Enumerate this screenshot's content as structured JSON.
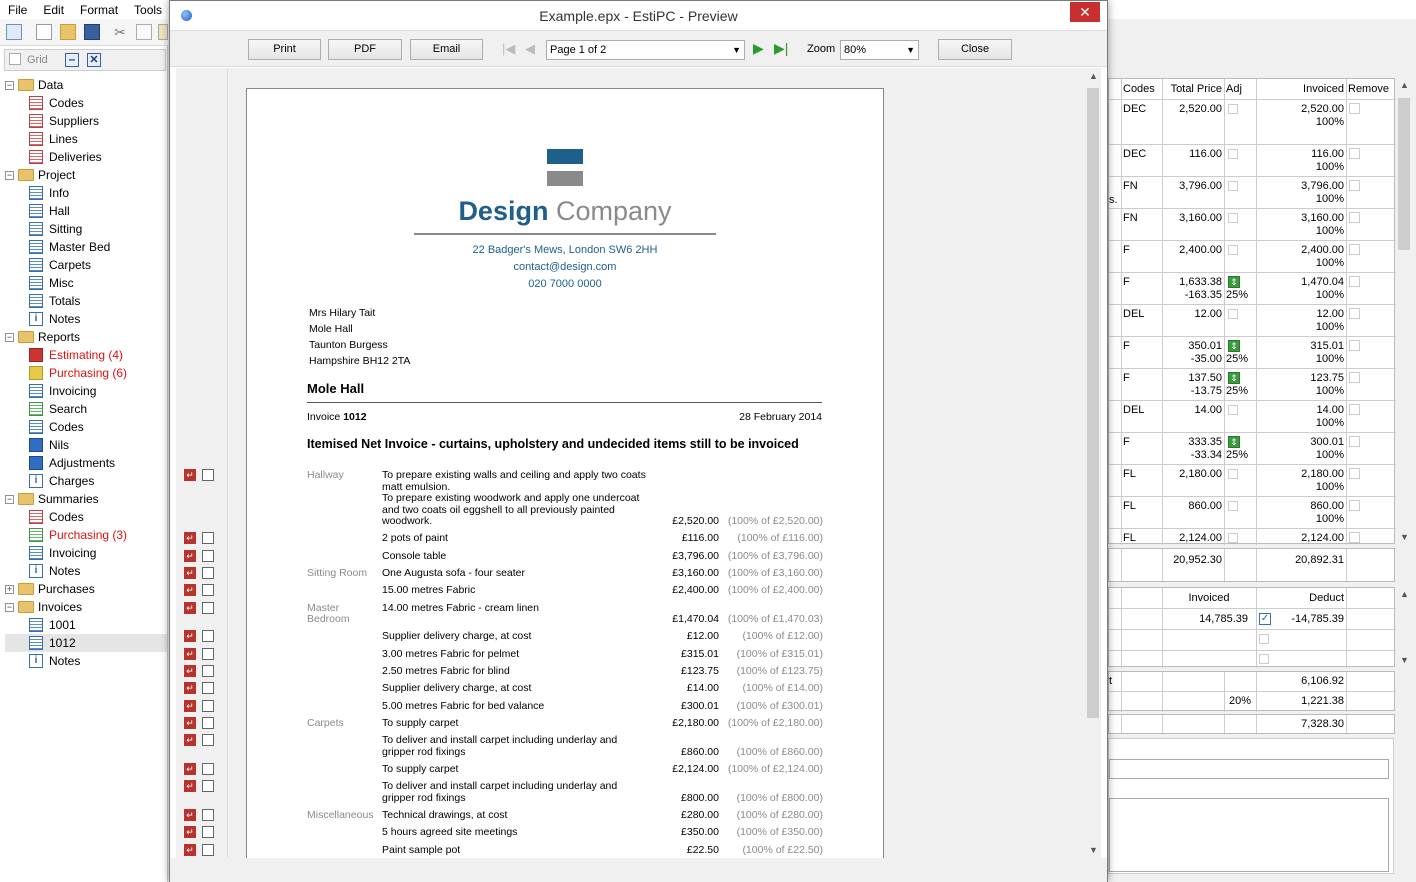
{
  "menu": [
    "File",
    "Edit",
    "Format",
    "Tools"
  ],
  "gridbar": {
    "label": "Grid"
  },
  "tree": [
    {
      "label": "Data",
      "lvl": 0,
      "exp": "−",
      "ico": "fold"
    },
    {
      "label": "Codes",
      "lvl": 1,
      "ico": "red"
    },
    {
      "label": "Suppliers",
      "lvl": 1,
      "ico": "red"
    },
    {
      "label": "Lines",
      "lvl": 1,
      "ico": "red"
    },
    {
      "label": "Deliveries",
      "lvl": 1,
      "ico": "red"
    },
    {
      "label": "Project",
      "lvl": 0,
      "exp": "−",
      "ico": "fold"
    },
    {
      "label": "Info",
      "lvl": 1,
      "ico": "blue"
    },
    {
      "label": "Hall",
      "lvl": 1,
      "ico": "blue"
    },
    {
      "label": "Sitting",
      "lvl": 1,
      "ico": "blue"
    },
    {
      "label": "Master Bed",
      "lvl": 1,
      "ico": "blue"
    },
    {
      "label": "Carpets",
      "lvl": 1,
      "ico": "blue"
    },
    {
      "label": "Misc",
      "lvl": 1,
      "ico": "blue"
    },
    {
      "label": "Totals",
      "lvl": 1,
      "ico": "blue"
    },
    {
      "label": "Notes",
      "lvl": 1,
      "ico": "info"
    },
    {
      "label": "Reports",
      "lvl": 0,
      "exp": "−",
      "ico": "fold"
    },
    {
      "label": "Estimating (4)",
      "lvl": 1,
      "ico": "rb",
      "red": true
    },
    {
      "label": "Purchasing (6)",
      "lvl": 1,
      "ico": "yb",
      "red": true
    },
    {
      "label": "Invoicing",
      "lvl": 1,
      "ico": "blue"
    },
    {
      "label": "Search",
      "lvl": 1,
      "ico": "grn"
    },
    {
      "label": "Codes",
      "lvl": 1,
      "ico": "blue"
    },
    {
      "label": "Nils",
      "lvl": 1,
      "ico": "bb"
    },
    {
      "label": "Adjustments",
      "lvl": 1,
      "ico": "bb"
    },
    {
      "label": "Charges",
      "lvl": 1,
      "ico": "info"
    },
    {
      "label": "Summaries",
      "lvl": 0,
      "exp": "−",
      "ico": "fold"
    },
    {
      "label": "Codes",
      "lvl": 1,
      "ico": "red"
    },
    {
      "label": "Purchasing (3)",
      "lvl": 1,
      "ico": "grn",
      "red": true
    },
    {
      "label": "Invoicing",
      "lvl": 1,
      "ico": "blue"
    },
    {
      "label": "Notes",
      "lvl": 1,
      "ico": "info"
    },
    {
      "label": "Purchases",
      "lvl": 0,
      "exp": "+",
      "ico": "fold"
    },
    {
      "label": "Invoices",
      "lvl": 0,
      "exp": "−",
      "ico": "fold"
    },
    {
      "label": "1001",
      "lvl": 1,
      "ico": "blue"
    },
    {
      "label": "1012",
      "lvl": 1,
      "ico": "blue",
      "sel": true
    },
    {
      "label": "Notes",
      "lvl": 1,
      "ico": "info"
    }
  ],
  "right": {
    "headers": [
      "Codes",
      "Total Price",
      "Adj",
      "Invoiced",
      "Remove"
    ],
    "rows": [
      {
        "code": "DEC",
        "price": "2,520.00",
        "adj": "",
        "inv": "2,520.00",
        "pct": "100%"
      },
      {
        "code": "DEC",
        "price": "116.00",
        "adj": "",
        "inv": "116.00",
        "pct": "100%"
      },
      {
        "code": "FN",
        "price": "3,796.00",
        "adj": "",
        "inv": "3,796.00",
        "pct": "100%"
      },
      {
        "code": "FN",
        "price": "3,160.00",
        "adj": "",
        "inv": "3,160.00",
        "pct": "100%"
      },
      {
        "code": "F",
        "price": "2,400.00",
        "adj": "",
        "inv": "2,400.00",
        "pct": "100%"
      },
      {
        "code": "F",
        "price": "1,633.38",
        "price2": "-163.35",
        "adj": "25%",
        "inv": "1,470.04",
        "pct": "100%"
      },
      {
        "code": "DEL",
        "price": "12.00",
        "adj": "",
        "inv": "12.00",
        "pct": "100%"
      },
      {
        "code": "F",
        "price": "350.01",
        "price2": "-35.00",
        "adj": "25%",
        "inv": "315.01",
        "pct": "100%"
      },
      {
        "code": "F",
        "price": "137.50",
        "price2": "-13.75",
        "adj": "25%",
        "inv": "123.75",
        "pct": "100%"
      },
      {
        "code": "DEL",
        "price": "14.00",
        "adj": "",
        "inv": "14.00",
        "pct": "100%"
      },
      {
        "code": "F",
        "price": "333.35",
        "price2": "-33.34",
        "adj": "25%",
        "inv": "300.01",
        "pct": "100%"
      },
      {
        "code": "FL",
        "price": "2,180.00",
        "adj": "",
        "inv": "2,180.00",
        "pct": "100%"
      },
      {
        "code": "FL",
        "price": "860.00",
        "adj": "",
        "inv": "860.00",
        "pct": "100%"
      },
      {
        "code": "FL",
        "price": "2,124.00",
        "adj": "",
        "inv": "2,124.00",
        "pct": ""
      }
    ],
    "cut_text": "s.",
    "total_price": "20,952.30",
    "total_inv": "20,892.31",
    "t2_headers": [
      "Invoiced",
      "Deduct"
    ],
    "t2_inv": "14,785.39",
    "t2_deduct": "-14,785.39",
    "sum1": "6,106.92",
    "vat_pct": "20%",
    "vat": "1,221.38",
    "grand": "7,328.30",
    "cut_t": "t"
  },
  "preview": {
    "title": "Example.epx - EstiPC - Preview",
    "buttons": {
      "print": "Print",
      "pdf": "PDF",
      "email": "Email",
      "close": "Close"
    },
    "page_select": "Page 1 of 2",
    "zoom_label": "Zoom",
    "zoom_value": "80%"
  },
  "invoice": {
    "company_bold": "Design",
    "company_light": "Company",
    "address": "22 Badger's Mews, London SW6 2HH",
    "email": "contact@design.com",
    "phone": "020 7000 0000",
    "client": [
      "Mrs Hilary Tait",
      "Mole Hall",
      "Taunton Burgess",
      "Hampshire BH12 2TA"
    ],
    "project": "Mole Hall",
    "invoice_label": "Invoice",
    "invoice_no": "1012",
    "date": "28 February 2014",
    "heading": "Itemised Net Invoice - curtains, upholstery and undecided items still to be invoiced",
    "lines": [
      {
        "room": "Hallway",
        "desc": [
          "To prepare existing walls and ceiling and apply two coats",
          "matt emulsion.",
          "To prepare existing woodwork and apply one undercoat",
          "and two coats oil eggshell to all previously painted",
          "woodwork."
        ],
        "amt": "£2,520.00",
        "pct": "(100% of £2,520.00)"
      },
      {
        "room": "",
        "desc": [
          "2 pots of paint"
        ],
        "amt": "£116.00",
        "pct": "(100% of £116.00)"
      },
      {
        "room": "",
        "desc": [
          "Console table"
        ],
        "amt": "£3,796.00",
        "pct": "(100% of £3,796.00)"
      },
      {
        "room": "Sitting Room",
        "desc": [
          "One Augusta  sofa - four seater"
        ],
        "amt": "£3,160.00",
        "pct": "(100% of £3,160.00)"
      },
      {
        "room": "",
        "desc": [
          "15.00 metres Fabric"
        ],
        "amt": "£2,400.00",
        "pct": "(100% of £2,400.00)"
      },
      {
        "room": "Master|Bedroom",
        "desc": [
          "14.00 metres Fabric - cream linen",
          ""
        ],
        "amt": "£1,470.04",
        "pct": "(100% of £1,470.03)"
      },
      {
        "room": "",
        "desc": [
          "Supplier delivery charge, at cost"
        ],
        "amt": "£12.00",
        "pct": "(100% of £12.00)"
      },
      {
        "room": "",
        "desc": [
          "3.00 metres Fabric for pelmet"
        ],
        "amt": "£315.01",
        "pct": "(100% of £315.01)"
      },
      {
        "room": "",
        "desc": [
          "2.50 metres Fabric for blind"
        ],
        "amt": "£123.75",
        "pct": "(100% of £123.75)"
      },
      {
        "room": "",
        "desc": [
          "Supplier delivery charge, at cost"
        ],
        "amt": "£14.00",
        "pct": "(100% of £14.00)"
      },
      {
        "room": "",
        "desc": [
          "5.00 metres Fabric for bed valance"
        ],
        "amt": "£300.01",
        "pct": "(100% of £300.01)"
      },
      {
        "room": "Carpets",
        "desc": [
          "To supply carpet"
        ],
        "amt": "£2,180.00",
        "pct": "(100% of £2,180.00)"
      },
      {
        "room": "",
        "desc": [
          "To deliver and install carpet including underlay and",
          "gripper rod fixings"
        ],
        "amt": "£860.00",
        "pct": "(100% of £860.00)"
      },
      {
        "room": "",
        "desc": [
          "To supply carpet"
        ],
        "amt": "£2,124.00",
        "pct": "(100% of £2,124.00)"
      },
      {
        "room": "",
        "desc": [
          "To deliver and install carpet including underlay and",
          "gripper rod fixings"
        ],
        "amt": "£800.00",
        "pct": "(100% of £800.00)"
      },
      {
        "room": "Miscellaneous",
        "desc": [
          "Technical drawings, at cost"
        ],
        "amt": "£280.00",
        "pct": "(100% of £280.00)"
      },
      {
        "room": "",
        "desc": [
          "5 hours agreed site meetings"
        ],
        "amt": "£350.00",
        "pct": "(100% of £350.00)"
      },
      {
        "room": "",
        "desc": [
          "Paint sample pot"
        ],
        "amt": "£22.50",
        "pct": "(100% of £22.50)"
      }
    ]
  },
  "colors": {
    "brand": "#1f5f8b",
    "grey": "#8a8a8a",
    "accent_red": "#b7332e"
  }
}
